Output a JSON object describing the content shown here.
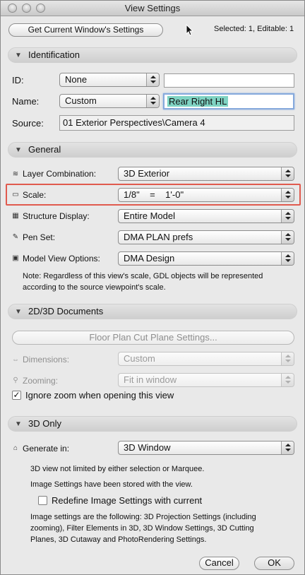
{
  "window": {
    "title": "View Settings"
  },
  "toolbar": {
    "get_settings_label": "Get Current Window's Settings",
    "status": "Selected: 1, Editable: 1"
  },
  "identification": {
    "header": "Identification",
    "id_label": "ID:",
    "id_value": "None",
    "name_label": "Name:",
    "name_value": "Custom",
    "name_text": "Rear Right HL",
    "source_label": "Source:",
    "source_value": "01 Exterior Perspectives\\Camera 4"
  },
  "general": {
    "header": "General",
    "layer_label": "Layer Combination:",
    "layer_value": "3D Exterior",
    "scale_label": "Scale:",
    "scale_value": "1/8\"    =    1'-0\"",
    "structure_label": "Structure Display:",
    "structure_value": "Entire Model",
    "penset_label": "Pen Set:",
    "penset_value": "DMA PLAN prefs",
    "mvo_label": "Model View Options:",
    "mvo_value": "DMA Design",
    "note_line1": "Note: Regardless of this view's scale, GDL objects will be represented",
    "note_line2": "according to the source viewpoint's scale."
  },
  "documents": {
    "header": "2D/3D Documents",
    "cutplane_label": "Floor Plan Cut Plane Settings...",
    "dimensions_label": "Dimensions:",
    "dimensions_value": "Custom",
    "zooming_label": "Zooming:",
    "zooming_value": "Fit in window",
    "ignore_zoom_label": "Ignore zoom when opening this view",
    "ignore_zoom_checked": true
  },
  "only3d": {
    "header": "3D Only",
    "generate_label": "Generate in:",
    "generate_value": "3D Window",
    "info1": "3D view not limited by either selection or Marquee.",
    "info2": "Image Settings have been stored with the view.",
    "redefine_label": "Redefine Image Settings with current",
    "redefine_checked": false,
    "desc_line1": "Image settings are the following: 3D Projection Settings (including",
    "desc_line2": "zooming), Filter Elements in 3D, 3D Window Settings, 3D Cutting",
    "desc_line3": "Planes, 3D Cutaway and PhotoRendering Settings."
  },
  "footer": {
    "cancel_label": "Cancel",
    "ok_label": "OK"
  },
  "icons": {
    "collapse": "triangle-down-icon",
    "layer": "layers-icon",
    "scale": "ruler-icon",
    "structure": "structure-icon",
    "penset": "pen-icon",
    "mvo": "model-view-icon",
    "dimensions": "dimension-icon",
    "zooming": "magnifier-icon",
    "generate": "generate-3d-icon"
  },
  "colors": {
    "highlight": "#e05a4e",
    "selection": "#7fd3c3",
    "popup_accent": "#3b5fb5"
  }
}
